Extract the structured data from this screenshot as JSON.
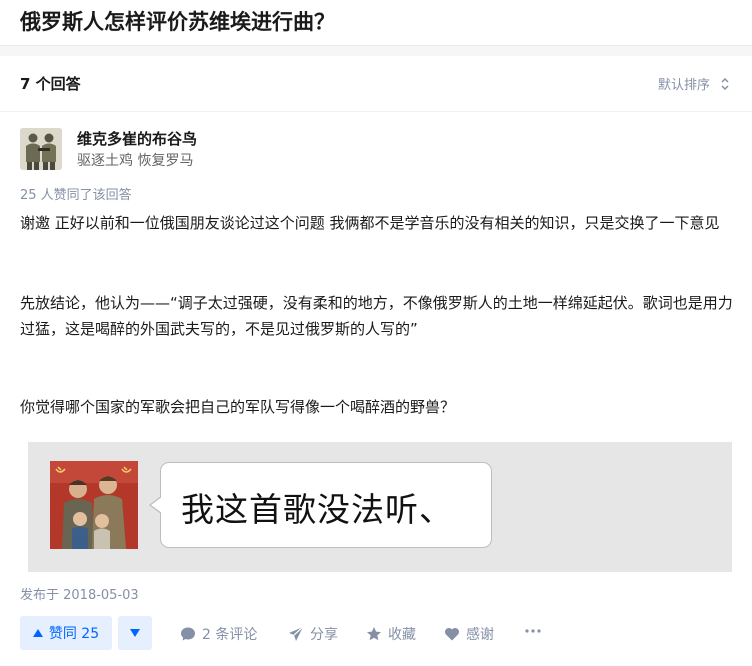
{
  "question": {
    "title": "俄罗斯人怎样评价苏维埃进行曲？"
  },
  "answers_bar": {
    "count_label": "7 个回答",
    "sort_label": "默认排序"
  },
  "answer": {
    "author": {
      "name": "维克多崔的布谷鸟",
      "bio": "驱逐土鸡 恢复罗马"
    },
    "votes_text": "25 人赞同了该回答",
    "paragraphs": [
      "谢邀 正好以前和一位俄国朋友谈论过这个问题 我俩都不是学音乐的没有相关的知识，只是交换了一下意见",
      "先放结论，他认为——“调子太过强硬，没有柔和的地方，不像俄罗斯人的土地一样绵延起伏。歌词也是用力过猛，这是喝醉的外国武夫写的，不是见过俄罗斯的人写的”",
      "你觉得哪个国家的军歌会把自己的军队写得像一个喝醉酒的野兽？"
    ],
    "meme_text": "我这首歌没法听、",
    "published": "发布于 2018-05-03",
    "actions": {
      "upvote_label": "赞同 25",
      "comments_label": "2 条评论",
      "share_label": "分享",
      "collect_label": "收藏",
      "thanks_label": "感谢"
    }
  },
  "colors": {
    "accent": "#0066ff",
    "vote_bg": "#e5effd",
    "muted": "#8590a6"
  }
}
